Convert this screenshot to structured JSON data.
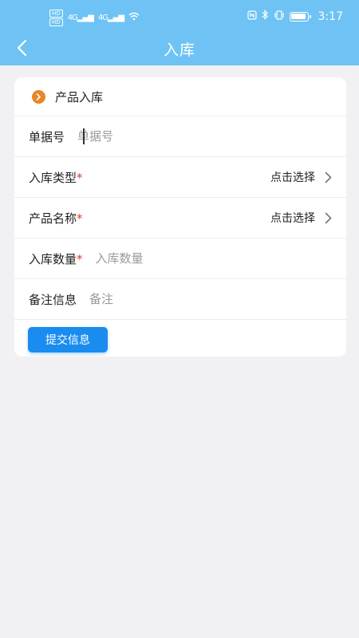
{
  "status": {
    "time": "3:17",
    "hd1": "HD",
    "hd2": "HD",
    "net1": "4G",
    "net2": "4G",
    "icons": [
      "nfc-icon",
      "bluetooth-icon",
      "vibrate-icon",
      "battery-icon",
      "wifi-icon",
      "signal-icon"
    ]
  },
  "nav": {
    "title": "入库",
    "back_icon": "chevron-left-icon"
  },
  "card": {
    "title": "产品入库",
    "title_icon": "chevron-right-circle-icon",
    "accent": "#e8862a"
  },
  "form": {
    "doc_no": {
      "label": "单据号",
      "placeholder": "单据号",
      "value": ""
    },
    "stock_type": {
      "label": "入库类型",
      "required_mark": "*",
      "picker_text": "点击选择"
    },
    "product_name": {
      "label": "产品名称",
      "required_mark": "*",
      "picker_text": "点击选择"
    },
    "quantity": {
      "label": "入库数量",
      "required_mark": "*",
      "placeholder": "入库数量",
      "value": ""
    },
    "remark": {
      "label": "备注信息",
      "placeholder": "备注",
      "value": ""
    }
  },
  "submit": {
    "label": "提交信息",
    "color": "#1a8cf0"
  },
  "colors": {
    "header": "#6ec3f4",
    "background": "#f1f1f3",
    "required": "#e0392b"
  }
}
